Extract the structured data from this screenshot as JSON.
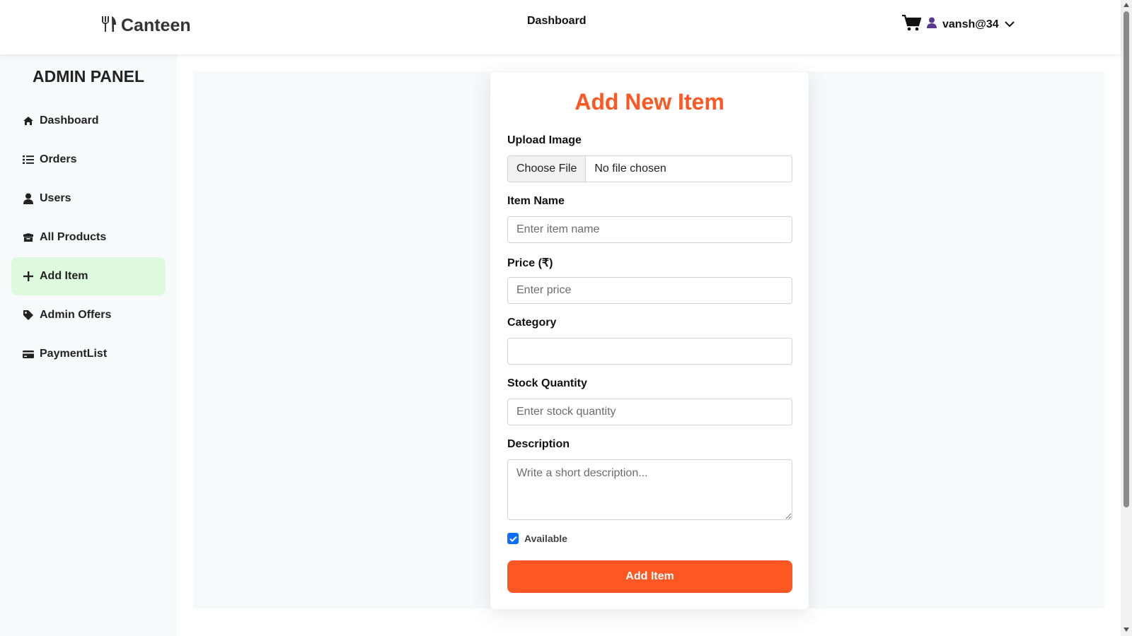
{
  "header": {
    "brand": "Canteen",
    "nav_center": "Dashboard",
    "user_name": "vansh@34"
  },
  "sidebar": {
    "title": "ADMIN PANEL",
    "active_item": "Add Item",
    "items": [
      {
        "label": "Dashboard",
        "icon": "home-icon"
      },
      {
        "label": "Orders",
        "icon": "list-icon"
      },
      {
        "label": "Users",
        "icon": "user-icon"
      },
      {
        "label": "All Products",
        "icon": "box-icon"
      },
      {
        "label": "Add Item",
        "icon": "plus-icon"
      },
      {
        "label": "Admin Offers",
        "icon": "tag-icon"
      },
      {
        "label": "PaymentList",
        "icon": "credit-card-icon"
      }
    ]
  },
  "form": {
    "title": "Add New Item",
    "upload_label": "Upload Image",
    "file_button": "Choose File",
    "file_status": "No file chosen",
    "name_label": "Item Name",
    "name_placeholder": "Enter item name",
    "price_label": "Price (₹)",
    "price_placeholder": "Enter price",
    "category_label": "Category",
    "category_value": "",
    "stock_label": "Stock Quantity",
    "stock_placeholder": "Enter stock quantity",
    "description_label": "Description",
    "description_placeholder": "Write a short description...",
    "available_label": "Available",
    "available_checked": true,
    "submit_label": "Add Item"
  },
  "colors": {
    "accent": "#ff5722",
    "active_bg": "#ddfadf",
    "checkbox": "#0d6efd"
  }
}
